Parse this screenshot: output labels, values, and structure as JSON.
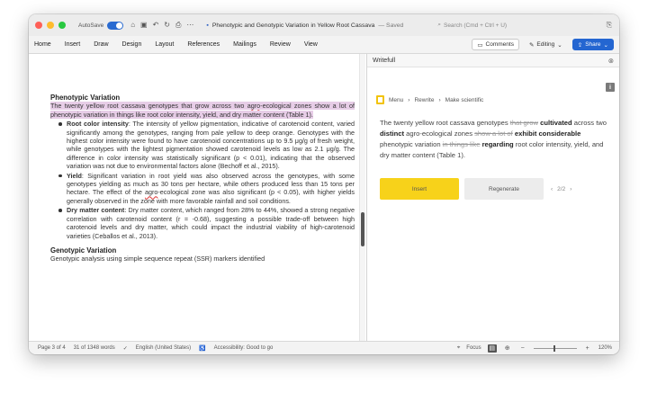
{
  "titlebar": {
    "autosave_label": "AutoSave",
    "doc_title": "Phenotypic and Genotypic Variation in Yellow Root Cassava",
    "saved_label": "— Saved",
    "search_placeholder": "Search (Cmd + Ctrl + U)"
  },
  "ribbon": {
    "tabs": [
      "Home",
      "Insert",
      "Draw",
      "Design",
      "Layout",
      "References",
      "Mailings",
      "Review",
      "View"
    ],
    "comments_label": "Comments",
    "editing_label": "Editing",
    "share_label": "Share"
  },
  "document": {
    "heading1": "Phenotypic Variation",
    "intro_a": "The twenty yellow root cassava genotypes that grow across two ",
    "intro_agro": "agro",
    "intro_b": "-ecological zones show a lot of phenotypic variation in things like root color intensity, yield, and dry matter content (Table 1).",
    "bullets": [
      {
        "term": "Root color intensity",
        "text": ": The intensity of yellow pigmentation, indicative of carotenoid content, varied significantly among the genotypes, ranging from pale yellow to deep orange. Genotypes with the highest color intensity were found to have carotenoid concentrations up to 9.5 μg/g of fresh weight, while genotypes with the lightest pigmentation showed carotenoid levels as low as 2.1 μg/g. The difference in color intensity was statistically significant (p < 0.01), indicating that the observed variation was not due to environmental factors alone (Bechoff et al., 2015)."
      },
      {
        "term": "Yield",
        "text_a": ": Significant variation in root yield was also observed across the genotypes, with some genotypes yielding as much as 30 tons per hectare, while others produced less than 15 tons per hectare. The effect of the ",
        "agro": "agro",
        "text_b": "-ecological zone was also significant (p < 0.05), with higher yields generally observed in the zone with more favorable rainfall and soil conditions."
      },
      {
        "term": "Dry matter content",
        "text": ": Dry matter content, which ranged from 28% to 44%, showed a strong negative correlation with carotenoid content (r = -0.68), suggesting a possible trade-off between high carotenoid levels and dry matter, which could impact the industrial viability of high-carotenoid varieties (Ceballos et al., 2013)."
      }
    ],
    "heading2": "Genotypic Variation",
    "geno_text": "Genotypic analysis using simple sequence repeat (SSR) markers identified"
  },
  "writefull": {
    "title": "Writefull",
    "breadcrumb": [
      "Menu",
      "Rewrite",
      "Make scientific"
    ],
    "rewrite": [
      {
        "t": "The twenty yellow root cassava genotypes ",
        "s": "n"
      },
      {
        "t": "that grow",
        "s": "d"
      },
      {
        "t": " ",
        "s": "n"
      },
      {
        "t": "cultivated",
        "s": "i"
      },
      {
        "t": " across two ",
        "s": "n"
      },
      {
        "t": "distinct",
        "s": "i"
      },
      {
        "t": " agro-ecological zones ",
        "s": "n"
      },
      {
        "t": "show a lot of",
        "s": "d"
      },
      {
        "t": " ",
        "s": "n"
      },
      {
        "t": "exhibit considerable",
        "s": "i"
      },
      {
        "t": " phenotypic variation ",
        "s": "n"
      },
      {
        "t": "in things like",
        "s": "d"
      },
      {
        "t": " ",
        "s": "n"
      },
      {
        "t": "regarding",
        "s": "i"
      },
      {
        "t": " root color intensity, yield, and dry matter content (Table 1).",
        "s": "n"
      }
    ],
    "insert_label": "Insert",
    "regenerate_label": "Regenerate",
    "pager": "2/2"
  },
  "statusbar": {
    "page": "Page 3 of 4",
    "words": "31 of 1348 words",
    "language": "English (United States)",
    "accessibility": "Accessibility: Good to go",
    "focus": "Focus",
    "zoom": "120%"
  },
  "colors": {
    "highlight": "#e7cde7",
    "insert_button": "#f7d21a",
    "share_button": "#2466d1"
  }
}
